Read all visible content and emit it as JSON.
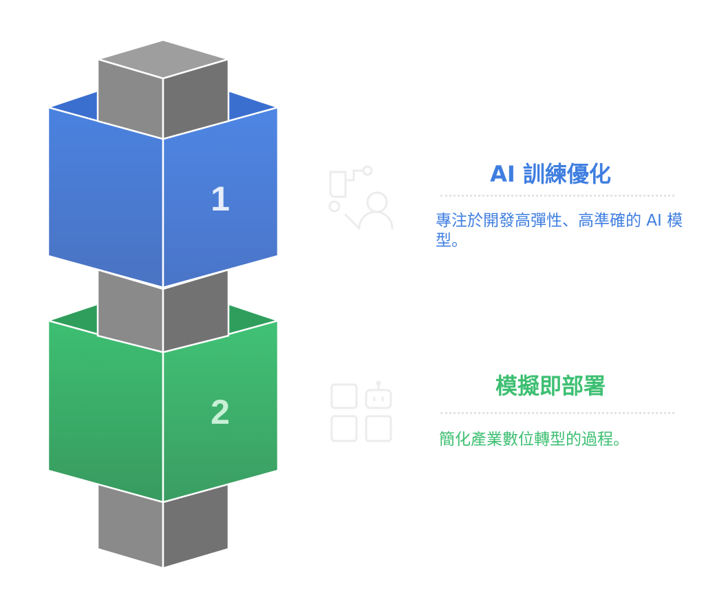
{
  "steps": [
    {
      "number": "1",
      "title": "AI 訓練優化",
      "description": "專注於開發高彈性、高準確的 AI 模型。",
      "icon": "ai-training-icon",
      "color": "#4a82e0",
      "title_color": "#3f7ee0"
    },
    {
      "number": "2",
      "title": "模擬即部署",
      "description": "簡化產業數位轉型的過程。",
      "icon": "robot-apps-icon",
      "color": "#3dbf72",
      "title_color": "#3dbf72"
    }
  ],
  "colors": {
    "core_light": "#8a8a8a",
    "core_dark": "#6f6f6f",
    "core_top": "#9e9e9e"
  }
}
